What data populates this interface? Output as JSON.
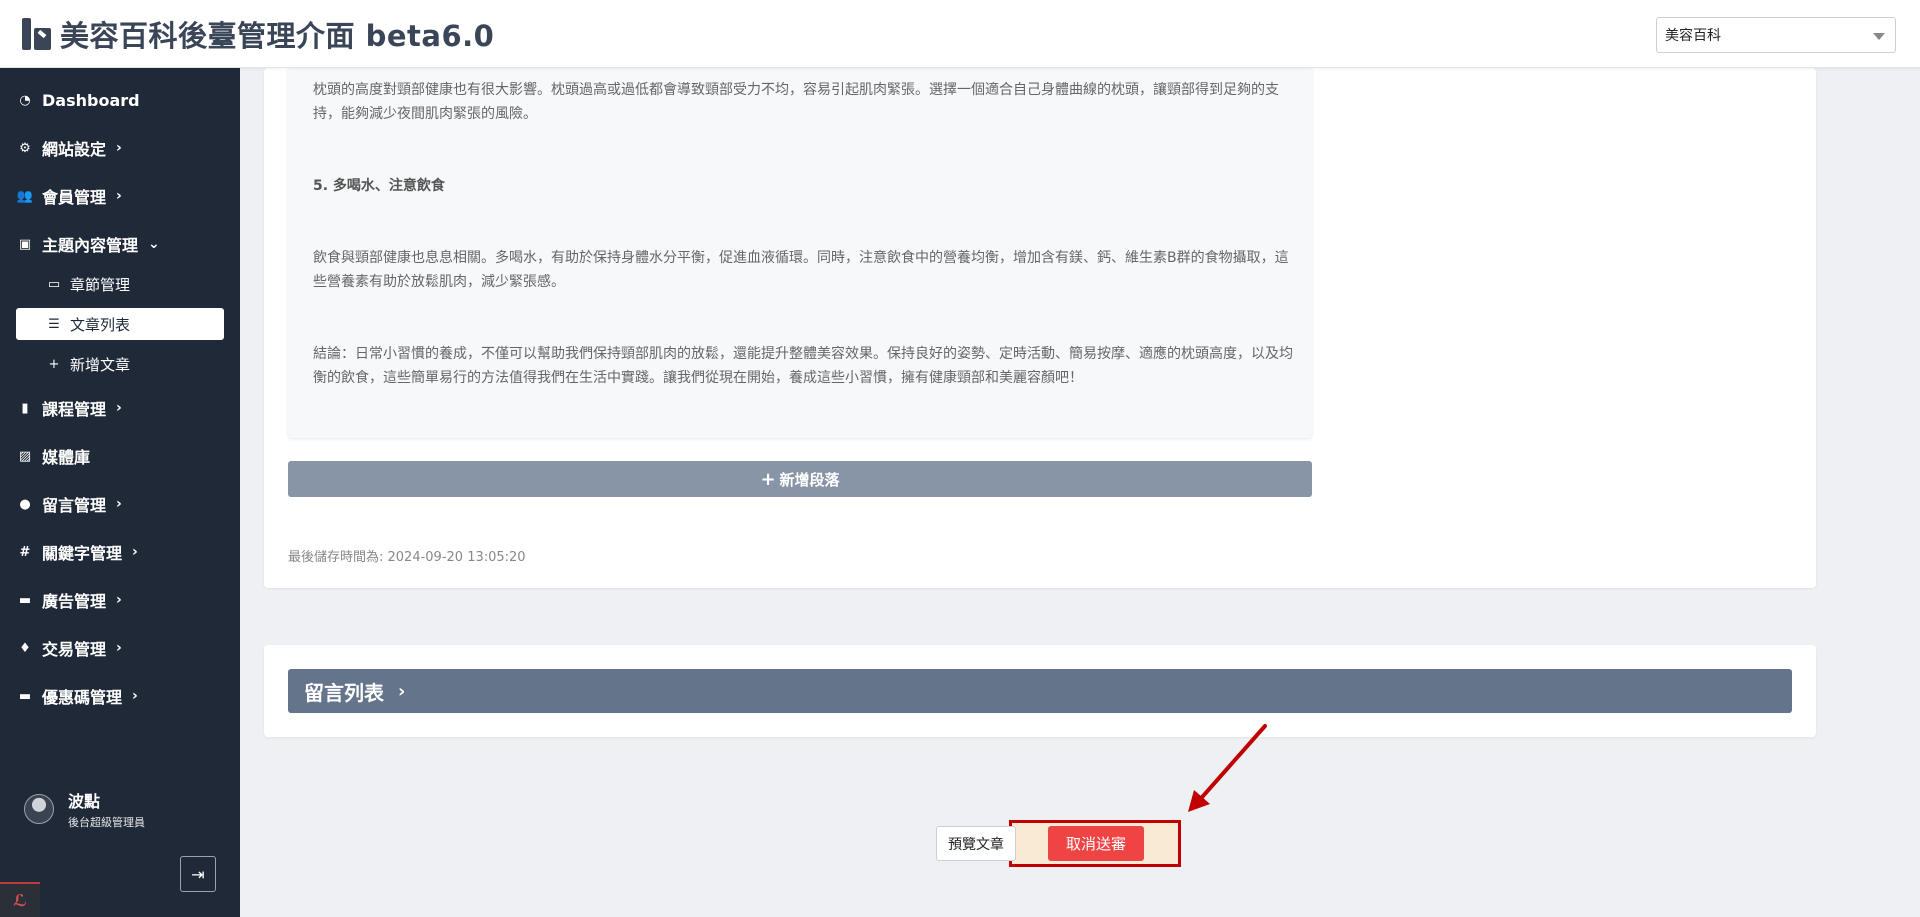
{
  "header": {
    "title": "美容百科後臺管理介面 beta6.0",
    "site_select_value": "美容百科"
  },
  "sidebar": {
    "items": [
      {
        "label": "Dashboard",
        "icon": "dashboard-icon"
      },
      {
        "label": "網站設定",
        "icon": "gear-icon"
      },
      {
        "label": "會員管理",
        "icon": "users-icon"
      },
      {
        "label": "主題內容管理",
        "icon": "book-icon",
        "expanded": true
      },
      {
        "label": "課程管理",
        "icon": "course-book-icon"
      },
      {
        "label": "媒體庫",
        "icon": "images-icon"
      },
      {
        "label": "留言管理",
        "icon": "comment-icon"
      },
      {
        "label": "關鍵字管理",
        "icon": "hash-icon"
      },
      {
        "label": "廣告管理",
        "icon": "ad-icon"
      },
      {
        "label": "交易管理",
        "icon": "money-bag-icon"
      },
      {
        "label": "優惠碼管理",
        "icon": "ticket-icon"
      }
    ],
    "subitems": [
      {
        "label": "章節管理",
        "icon": "chapter-icon"
      },
      {
        "label": "文章列表",
        "icon": "list-icon",
        "active": true
      },
      {
        "label": "新增文章",
        "icon": "plus-icon"
      }
    ],
    "user": {
      "name": "波點",
      "role": "後台超級管理員"
    }
  },
  "article": {
    "para1": "枕頭的高度對頸部健康也有很大影響。枕頭過高或過低都會導致頸部受力不均，容易引起肌肉緊張。選擇一個適合自己身體曲線的枕頭，讓頸部得到足夠的支持，能夠減少夜間肌肉緊張的風險。",
    "heading5": "5. 多喝水、注意飲食",
    "para2": "飲食與頸部健康也息息相關。多喝水，有助於保持身體水分平衡，促進血液循環。同時，注意飲食中的營養均衡，增加含有鎂、鈣、維生素B群的食物攝取，這些營養素有助於放鬆肌肉，減少緊張感。",
    "conclusion": "結論：日常小習慣的養成，不僅可以幫助我們保持頸部肌肉的放鬆，還能提升整體美容效果。保持良好的姿勢、定時活動、簡易按摩、適應的枕頭高度，以及均衡的飲食，這些簡單易行的方法值得我們在生活中實踐。讓我們從現在開始，養成這些小習慣，擁有健康頸部和美麗容顏吧！",
    "add_paragraph_label": "新增段落",
    "last_saved": "最後儲存時間為: 2024-09-20 13:05:20"
  },
  "comments": {
    "label": "留言列表"
  },
  "actions": {
    "preview_label": "預覽文章",
    "cancel_label": "取消送審"
  },
  "colors": {
    "sidebar_bg": "#1f2937",
    "cancel_button": "#ef4444",
    "highlight_border": "#c00000"
  }
}
